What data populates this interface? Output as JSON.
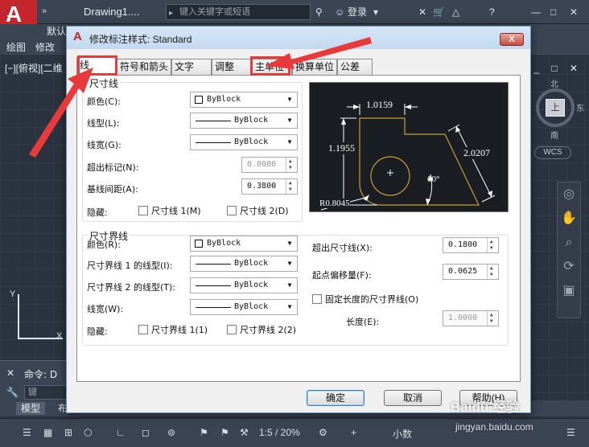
{
  "app": {
    "logo_letter": "A",
    "document_title": "Drawing1....",
    "search_placeholder": "键入关键字或短语",
    "login_label": "登录",
    "help_symbol": "?",
    "ribbon_tabs": [
      "默认"
    ],
    "menu_row": [
      "绘图",
      "修改"
    ],
    "view_label": "[−][俯视][二维",
    "window_controls": "_ □ ✕",
    "viewcube": {
      "face": "上",
      "north": "北",
      "east": "东",
      "south": "南",
      "wcs": "WCS"
    },
    "ucs": {
      "x": "X",
      "y": "Y"
    },
    "command": {
      "close": "✕",
      "label": "命令: D",
      "input_placeholder": "键"
    },
    "model_tabs": [
      "模型",
      "布"
    ],
    "status": {
      "scale": "1:5 / 20%",
      "units": "小数"
    }
  },
  "dialog": {
    "title": "修改标注样式: Standard",
    "close_label": "X",
    "tabs": [
      "线",
      "符号和箭头",
      "文字",
      "调整",
      "主单位",
      "换算单位",
      "公差"
    ],
    "active_tab": "线",
    "dim_lines": {
      "title": "尺寸线",
      "color_label": "颜色(C):",
      "color_value": "ByBlock",
      "linetype_label": "线型(L):",
      "linetype_value": "ByBlock",
      "lineweight_label": "线宽(G):",
      "lineweight_value": "ByBlock",
      "extend_ticks_label": "超出标记(N):",
      "extend_ticks_value": "0.0000",
      "baseline_spacing_label": "基线间距(A):",
      "baseline_spacing_value": "0.3800",
      "suppress_label": "隐藏:",
      "suppress_1": "尺寸线 1(M)",
      "suppress_2": "尺寸线 2(D)"
    },
    "ext_lines": {
      "title": "尺寸界线",
      "color_label": "颜色(R):",
      "color_value": "ByBlock",
      "linetype1_label": "尺寸界线 1 的线型(I):",
      "linetype1_value": "ByBlock",
      "linetype2_label": "尺寸界线 2 的线型(T):",
      "linetype2_value": "ByBlock",
      "lineweight_label": "线宽(W):",
      "lineweight_value": "ByBlock",
      "suppress_label": "隐藏:",
      "suppress_1": "尺寸界线 1(1)",
      "suppress_2": "尺寸界线 2(2)",
      "extend_beyond_label": "超出尺寸线(X):",
      "extend_beyond_value": "0.1800",
      "offset_label": "起点偏移量(F):",
      "offset_value": "0.0625",
      "fixed_length_label": "固定长度的尺寸界线(O)",
      "length_label": "长度(E):",
      "length_value": "1.0000"
    },
    "preview": {
      "dim_top": "1.0159",
      "dim_left": "1.1955",
      "dim_right": "2.0207",
      "angle": "60°",
      "radius": "R0.8045"
    },
    "buttons": {
      "ok": "确定",
      "cancel": "取消",
      "help": "帮助(H)"
    }
  },
  "watermark": {
    "line1": "Baidu 经验",
    "line2": "jingyan.baidu.com"
  },
  "colors": {
    "highlight": "#e83a3a",
    "preview_line": "#c8a036",
    "acad_bg": "#2b3340"
  }
}
